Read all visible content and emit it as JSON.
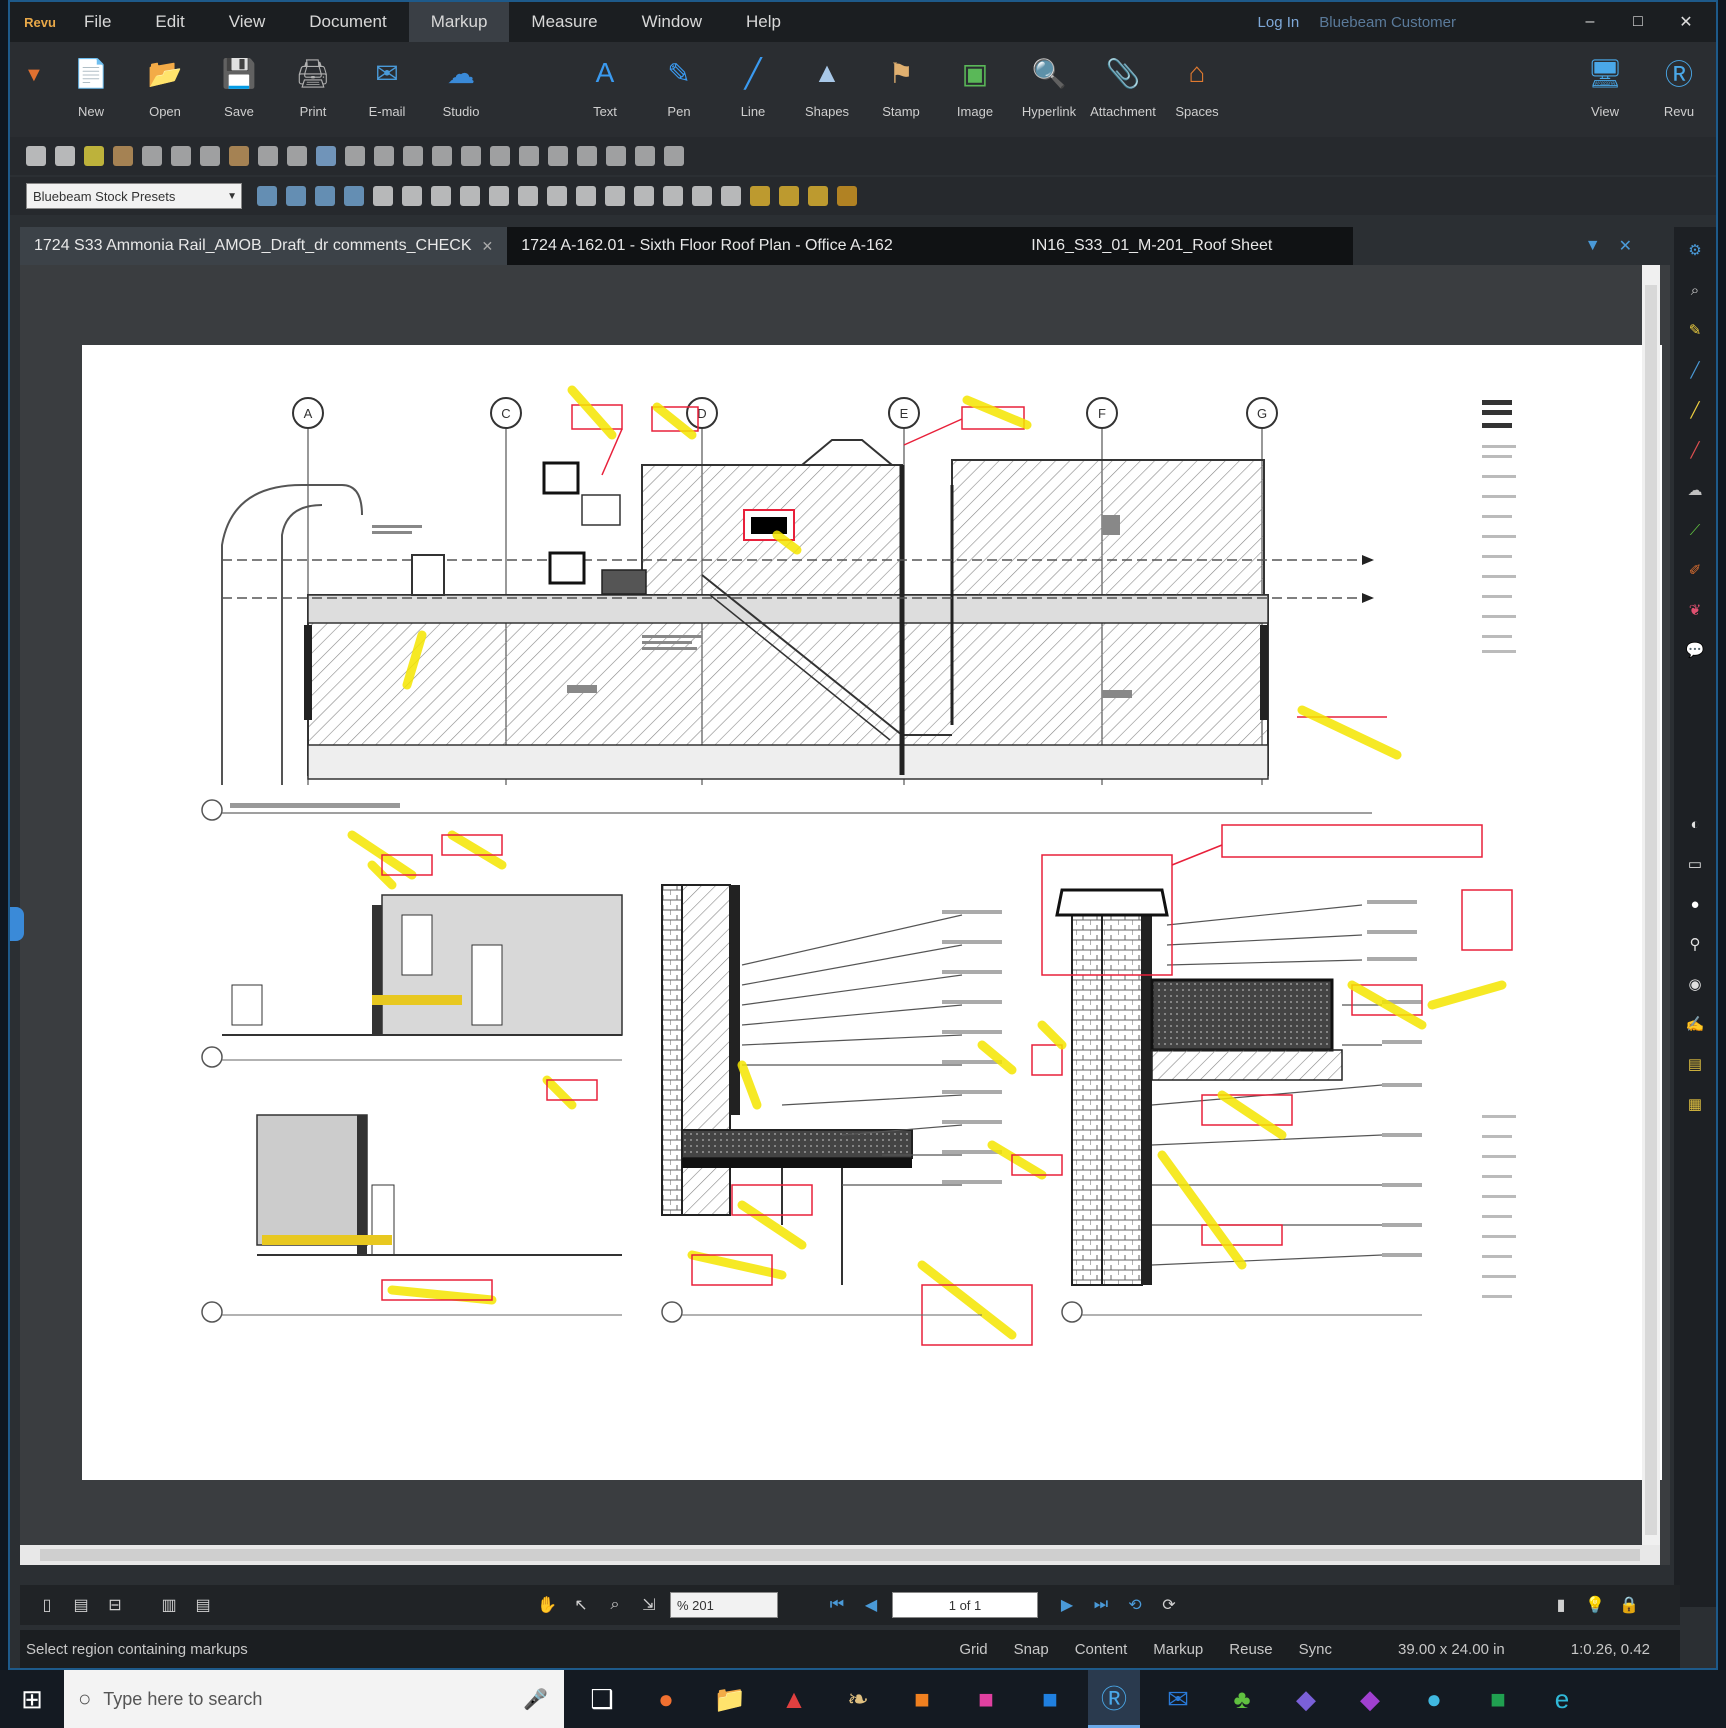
{
  "menu": {
    "logo": "Revu",
    "items": [
      "File",
      "Edit",
      "View",
      "Document",
      "Markup",
      "Measure",
      "Window",
      "Help"
    ],
    "active": "Markup",
    "right_links": [
      "Log In",
      "Bluebeam Customer"
    ],
    "window_controls": [
      "–",
      "□",
      "✕"
    ]
  },
  "toolbar_main": {
    "tools": [
      {
        "label": "New",
        "icon": "new-document-icon",
        "glyph": "📄",
        "color": "#f0c040"
      },
      {
        "label": "Open",
        "icon": "open-folder-icon",
        "glyph": "📂",
        "color": "#c89048"
      },
      {
        "label": "Save",
        "icon": "save-icon",
        "glyph": "💾",
        "color": "#909090"
      },
      {
        "label": "Print",
        "icon": "print-icon",
        "glyph": "🖨",
        "color": "#b0b0b0"
      },
      {
        "label": "E-mail",
        "icon": "email-icon",
        "glyph": "✉",
        "color": "#4a9ad8"
      },
      {
        "label": "Studio",
        "icon": "studio-icon",
        "glyph": "☁",
        "color": "#3a8ad8"
      },
      {
        "label": "Text",
        "icon": "text-tool-icon",
        "glyph": "A",
        "color": "#3a9af0"
      },
      {
        "label": "Pen",
        "icon": "pen-tool-icon",
        "glyph": "✎",
        "color": "#3a9af0"
      },
      {
        "label": "Line",
        "icon": "line-tool-icon",
        "glyph": "╱",
        "color": "#3a9af0"
      },
      {
        "label": "Shapes",
        "icon": "shapes-tool-icon",
        "glyph": "▲",
        "color": "#a8c8e8"
      },
      {
        "label": "Stamp",
        "icon": "stamp-tool-icon",
        "glyph": "⚑",
        "color": "#e0b070"
      },
      {
        "label": "Image",
        "icon": "image-tool-icon",
        "glyph": "▣",
        "color": "#5ab858"
      },
      {
        "label": "Hyperlink",
        "icon": "hyperlink-tool-icon",
        "glyph": "🔍",
        "color": "#5ab838"
      },
      {
        "label": "Attachment",
        "icon": "attachment-tool-icon",
        "glyph": "📎",
        "color": "#e0a040"
      },
      {
        "label": "Spaces",
        "icon": "spaces-tool-icon",
        "glyph": "⌂",
        "color": "#e07a30"
      }
    ],
    "right_tools": [
      {
        "label": "View",
        "icon": "view-icon",
        "glyph": "🖥",
        "color": "#4aa8e8"
      },
      {
        "label": "Revu",
        "icon": "revu-logo-icon",
        "glyph": "Ⓡ",
        "color": "#4aa8e8"
      }
    ]
  },
  "toolbar_small1": {
    "icons": [
      {
        "icon": "new-doc-small-icon",
        "color": "#e8e8e8"
      },
      {
        "icon": "close-doc-small-icon",
        "color": "#e8e8e8"
      },
      {
        "icon": "highlight-small-icon",
        "color": "#f0e040"
      },
      {
        "icon": "folder-small-icon",
        "color": "#d0a060"
      },
      {
        "icon": "calculator-small-icon",
        "color": "#c8c8c8"
      },
      {
        "icon": "print-small-icon",
        "color": "#c8c8c8"
      },
      {
        "icon": "email-small-icon",
        "color": "#c8c8c8"
      },
      {
        "icon": "package-small-icon",
        "color": "#d0a060"
      },
      {
        "icon": "link-small-icon",
        "color": "#c8c8c8"
      },
      {
        "icon": "check-small-icon",
        "color": "#c8c8c8"
      },
      {
        "icon": "select-small-icon",
        "color": "#8ab8e8"
      },
      {
        "icon": "pan-small-icon",
        "color": "#c8c8c8"
      },
      {
        "icon": "zoom-small-icon",
        "color": "#c8c8c8"
      },
      {
        "icon": "pencil-small-icon",
        "color": "#c8c8c8"
      },
      {
        "icon": "undo-small-icon",
        "color": "#c8c8c8"
      },
      {
        "icon": "redo-small-icon",
        "color": "#c8c8c8"
      },
      {
        "icon": "cut-small-icon",
        "color": "#c8c8c8"
      },
      {
        "icon": "copy-small-icon",
        "color": "#c8c8c8"
      },
      {
        "icon": "paste-small-icon",
        "color": "#c8c8c8"
      },
      {
        "icon": "align-left-small-icon",
        "color": "#c8c8c8"
      },
      {
        "icon": "align-center-small-icon",
        "color": "#c8c8c8"
      },
      {
        "icon": "align-right-small-icon",
        "color": "#c8c8c8"
      },
      {
        "icon": "distribute-small-icon",
        "color": "#c8c8c8"
      }
    ]
  },
  "toolbar_small2": {
    "combo_value": "Bluebeam Stock Presets",
    "icons": [
      {
        "icon": "measure-small-icon",
        "color": "#7ab0e0"
      },
      {
        "icon": "area-small-icon",
        "color": "#7ab0e0"
      },
      {
        "icon": "perimeter-small-icon",
        "color": "#7ab0e0"
      },
      {
        "icon": "volume-small-icon",
        "color": "#7ab0e0"
      },
      {
        "icon": "pen-small-icon",
        "color": "#e8e8e8"
      },
      {
        "icon": "line-small-icon",
        "color": "#e8e8e8"
      },
      {
        "icon": "arrow-small-icon",
        "color": "#e8e8e8"
      },
      {
        "icon": "cloud-small-icon",
        "color": "#e8e8e8"
      },
      {
        "icon": "callout-small-icon",
        "color": "#e8e8e8"
      },
      {
        "icon": "circle-small-icon",
        "color": "#e8e8e8"
      },
      {
        "icon": "triangle-small-icon",
        "color": "#e8e8e8"
      },
      {
        "icon": "polygon-small-icon",
        "color": "#e8e8e8"
      },
      {
        "icon": "image-small-icon",
        "color": "#e8e8e8"
      },
      {
        "icon": "stamp-small-icon",
        "color": "#e8e8e8"
      },
      {
        "icon": "snapshot-small-icon",
        "color": "#e8e8e8"
      },
      {
        "icon": "eraser-small-icon",
        "color": "#e8e8e8"
      },
      {
        "icon": "crop-small-icon",
        "color": "#e8e8e8"
      },
      {
        "icon": "highlighter-small-icon",
        "color": "#f0c030"
      },
      {
        "icon": "note-small-icon",
        "color": "#f0c030"
      },
      {
        "icon": "sticky-small-icon",
        "color": "#f0c030"
      },
      {
        "icon": "lock-small-icon",
        "color": "#e0a020"
      }
    ]
  },
  "tabs": [
    {
      "label": "1724 S33 Ammonia Rail_AMOB_Draft_dr comments_CHECK",
      "active": true
    },
    {
      "label": "1724 A-162.01 - Sixth Floor Roof Plan - Office A-162",
      "active": false
    },
    {
      "label": "IN16_S33_01_M-201_Roof Sheet",
      "active": false
    }
  ],
  "drawing": {
    "grid_labels": [
      "A",
      "C",
      "D",
      "E",
      "F",
      "G"
    ]
  },
  "navbar": {
    "zoom": "% 201",
    "page": "1 of 1"
  },
  "statusbar": {
    "message": "Select region containing markups",
    "toggles": [
      "Grid",
      "Snap",
      "Content",
      "Markup",
      "Reuse",
      "Sync"
    ],
    "dimensions": "39.00 x 24.00 in",
    "scale": "1:0.26, 0.42"
  },
  "taskbar": {
    "search_placeholder": "Type here to search",
    "apps": [
      {
        "icon": "task-view-icon",
        "glyph": "❑",
        "color": "#ffffff"
      },
      {
        "icon": "firefox-icon",
        "glyph": "●",
        "color": "#f07030"
      },
      {
        "icon": "file-explorer-icon",
        "glyph": "📁",
        "color": "#f0c040"
      },
      {
        "icon": "acrobat-icon",
        "glyph": "▲",
        "color": "#e04040"
      },
      {
        "icon": "bird-app-icon",
        "glyph": "❧",
        "color": "#e0c080"
      },
      {
        "icon": "orange-app-icon",
        "glyph": "■",
        "color": "#f08020"
      },
      {
        "icon": "pink-app-icon",
        "glyph": "■",
        "color": "#e040a0"
      },
      {
        "icon": "blue-app-icon",
        "glyph": "■",
        "color": "#2080e0"
      },
      {
        "icon": "bluebeam-taskbar-icon",
        "glyph": "Ⓡ",
        "color": "#4aa8e8",
        "active": true
      },
      {
        "icon": "outlook-icon",
        "glyph": "✉",
        "color": "#2a7ad8"
      },
      {
        "icon": "network-icon",
        "glyph": "♣",
        "color": "#60c040"
      },
      {
        "icon": "teams-icon",
        "glyph": "◆",
        "color": "#7a60d8"
      },
      {
        "icon": "onenote-icon",
        "glyph": "◆",
        "color": "#a040d0"
      },
      {
        "icon": "globe-icon",
        "glyph": "●",
        "color": "#40b8e0"
      },
      {
        "icon": "excel-icon",
        "glyph": "■",
        "color": "#20a050"
      },
      {
        "icon": "edge-icon",
        "glyph": "e",
        "color": "#30b8d8"
      }
    ]
  },
  "colors": {
    "accent": "#3a8ad8",
    "markup_yellow": "#f5e600",
    "markup_red": "#e8203a",
    "chrome_dark": "#1b1e21"
  }
}
